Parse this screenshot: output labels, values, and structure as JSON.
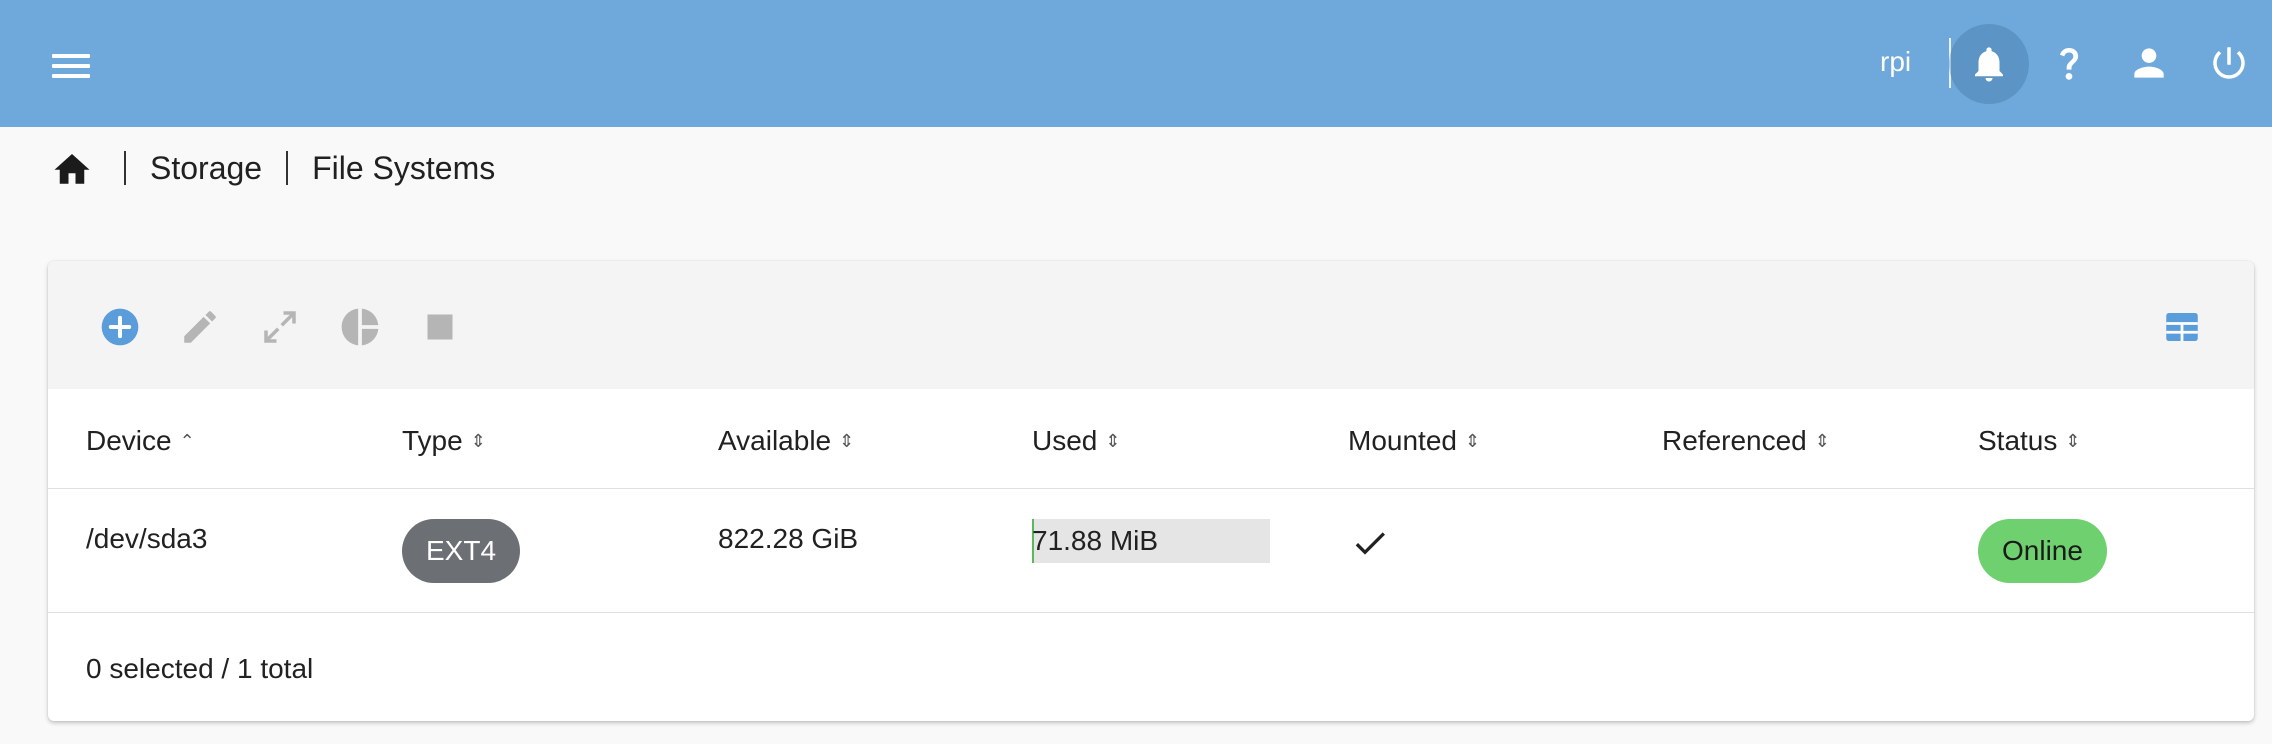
{
  "topbar": {
    "menu_icon": "menu-icon",
    "hostname": "rpi",
    "icons": [
      "bell-icon",
      "help-icon",
      "user-icon",
      "power-icon"
    ],
    "accent_color": "#6fa9db"
  },
  "breadcrumb": {
    "home_icon": "home-icon",
    "items": [
      "Storage",
      "File Systems"
    ]
  },
  "toolbar": {
    "buttons": [
      {
        "icon": "add-circle-icon",
        "enabled": true
      },
      {
        "icon": "pencil-icon",
        "enabled": false
      },
      {
        "icon": "expand-icon",
        "enabled": false
      },
      {
        "icon": "pie-chart-icon",
        "enabled": false
      },
      {
        "icon": "stop-icon",
        "enabled": false
      }
    ],
    "view_toggle_icon": "table-grid-icon"
  },
  "table": {
    "columns": [
      {
        "label": "Device",
        "sort": "asc"
      },
      {
        "label": "Type",
        "sort": "none"
      },
      {
        "label": "Available",
        "sort": "none"
      },
      {
        "label": "Used",
        "sort": "none"
      },
      {
        "label": "Mounted",
        "sort": "none"
      },
      {
        "label": "Referenced",
        "sort": "none"
      },
      {
        "label": "Status",
        "sort": "none"
      }
    ],
    "rows": [
      {
        "device": "/dev/sda3",
        "type": "EXT4",
        "available": "822.28 GiB",
        "used": "71.88 MiB",
        "used_fraction": 0.0001,
        "mounted": true,
        "referenced": "",
        "status": "Online",
        "status_color": "#6ed06e"
      }
    ],
    "footer": "0 selected / 1 total"
  }
}
